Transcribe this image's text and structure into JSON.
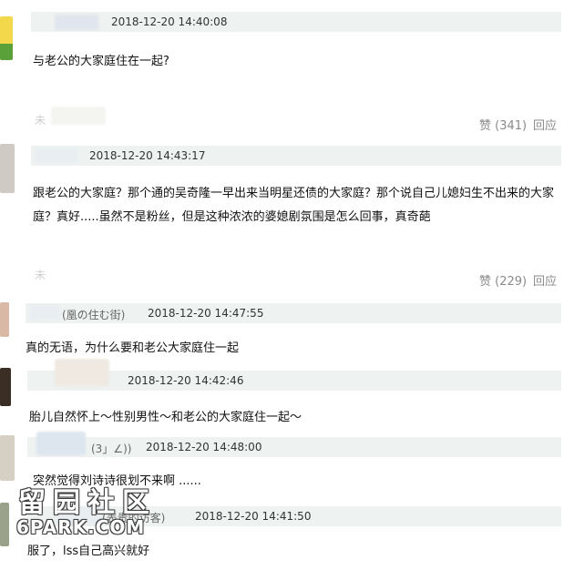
{
  "comments": [
    {
      "timestamp": "2018-12-20 14:40:08",
      "text": "与老公的大家庭住在一起?",
      "likes": "赞 (341)",
      "reply": "回应"
    },
    {
      "timestamp": "2018-12-20 14:43:17",
      "text": "跟老公的大家庭？那个通的吴奇隆一早出来当明星还债的大家庭？那个说自己儿媳妇生不出来的大家庭？真好.....虽然不是粉丝，但是这种浓浓的婆媳剧氛围是怎么回事，真奇葩",
      "likes": "赞 (229)",
      "reply": "回应"
    },
    {
      "nickname": "(凰の住む街)",
      "timestamp": "2018-12-20 14:47:55",
      "text": "真的无语，为什么要和老公大家庭住一起"
    },
    {
      "timestamp": "2018-12-20 14:42:46",
      "text": "胎儿自然怀上～性别男性～和老公的大家庭住一起～"
    },
    {
      "nickname": "(3」∠))",
      "timestamp": "2018-12-20 14:48:00",
      "text": "突然觉得刘诗诗很划不来啊 ......"
    },
    {
      "nickname": "(表贵的访客)",
      "timestamp": "2018-12-20 14:41:50",
      "text": "服了，lss自己高兴就好"
    }
  ],
  "watermark": {
    "cn": "留园社区",
    "en": "6PARK.COM"
  },
  "colors": {
    "header_bar": "#eef2f0",
    "action_text": "#8a8a8a"
  }
}
